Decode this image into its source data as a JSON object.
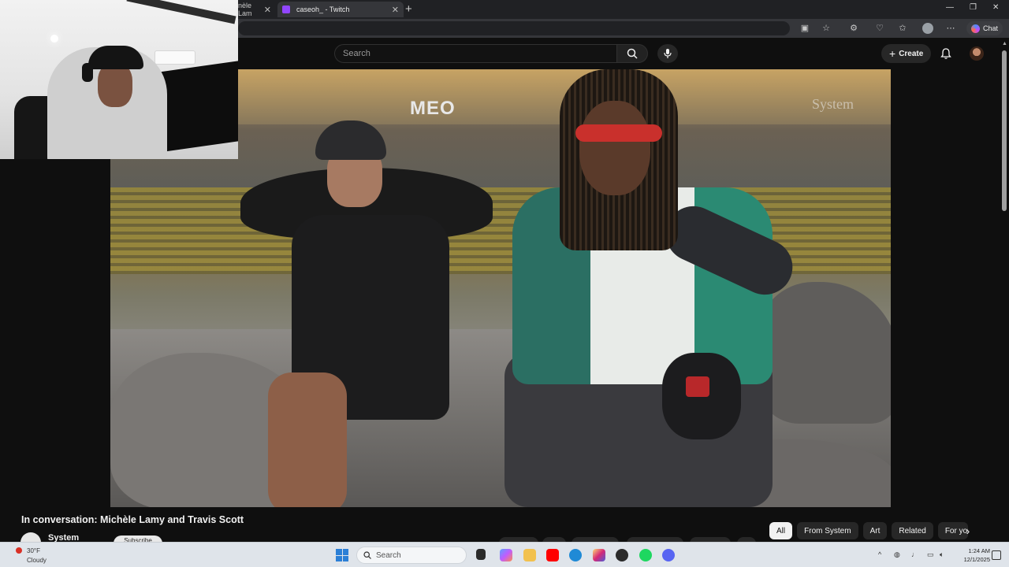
{
  "browser": {
    "tabs": [
      {
        "label": "nèle Lam",
        "active": false
      },
      {
        "label": "caseoh_ - Twitch",
        "active": true
      }
    ],
    "new_tab_icon": "plus-icon",
    "chat_label": "Chat",
    "window_controls": [
      "minimize-icon",
      "maximize-icon",
      "close-icon"
    ]
  },
  "youtube": {
    "search": {
      "placeholder": "Search"
    },
    "create_label": "Create",
    "notifications_icon": "bell-icon"
  },
  "video": {
    "title": "In conversation: Michèle Lamy and Travis Scott",
    "channel": "System",
    "subscribe_label": "Subscribe",
    "scene_text": "MEO",
    "watermark": "System"
  },
  "chips": [
    {
      "label": "All",
      "active": true
    },
    {
      "label": "From System",
      "active": false
    },
    {
      "label": "Art",
      "active": false
    },
    {
      "label": "Related",
      "active": false
    },
    {
      "label": "For you",
      "active": false
    }
  ],
  "taskbar": {
    "weather_temp": "30°F",
    "weather_condition": "Cloudy",
    "search_label": "Search",
    "time": "1:24 AM",
    "date": "12/1/2025"
  },
  "colors": {
    "page_bg": "#0f0f0f",
    "twitch": "#9146ff",
    "youtube_red": "#ff0000",
    "taskbar_bg": "#dfe4ea"
  }
}
